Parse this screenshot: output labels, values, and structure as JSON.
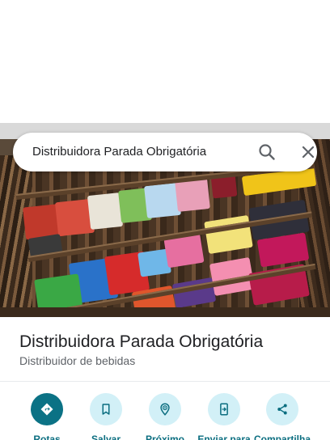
{
  "search": {
    "query": "Distribuidora Parada Obrigatória"
  },
  "place": {
    "name": "Distribuidora Parada Obrigatória",
    "category": "Distribuidor de bebidas"
  },
  "actions": [
    {
      "label": "Rotas",
      "icon": "directions-icon"
    },
    {
      "label": "Salvar",
      "icon": "bookmark-icon"
    },
    {
      "label": "Próximo",
      "icon": "nearby-icon"
    },
    {
      "label": "Enviar para",
      "icon": "send-to-phone-icon"
    },
    {
      "label": "Compartilha",
      "icon": "share-icon"
    }
  ],
  "colors": {
    "accent": "#0b7285",
    "accent_light": "#d2f0f7",
    "text_primary": "#202124",
    "text_secondary": "#5f6368"
  }
}
